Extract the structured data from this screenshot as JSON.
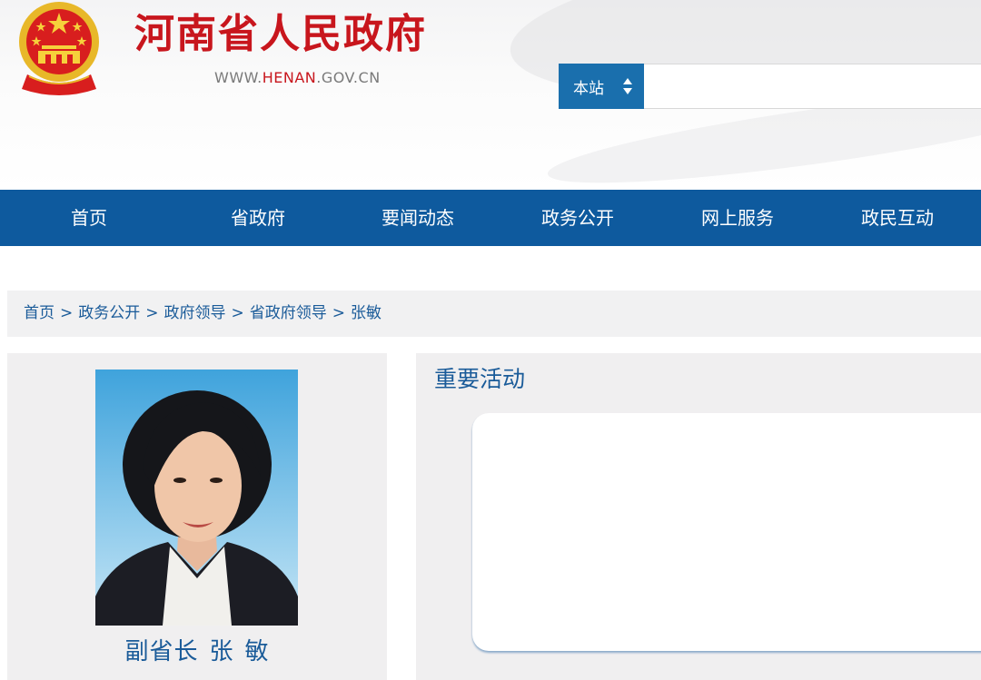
{
  "header": {
    "site_title": "河南省人民政府",
    "url_prefix": "WWW.",
    "url_highlight": "HENAN",
    "url_suffix": ".GOV.CN",
    "search_scope_label": "本站",
    "search_placeholder": ""
  },
  "nav": {
    "items": [
      {
        "label": "首页"
      },
      {
        "label": "省政府"
      },
      {
        "label": "要闻动态"
      },
      {
        "label": "政务公开"
      },
      {
        "label": "网上服务"
      },
      {
        "label": "政民互动"
      }
    ]
  },
  "breadcrumb": {
    "items": [
      "首页",
      "政务公开",
      "政府领导",
      "省政府领导",
      "张敏"
    ],
    "separator": ">"
  },
  "leader": {
    "title": "副省长",
    "surname": "张",
    "given_name": "敏"
  },
  "activities": {
    "section_title": "重要活动"
  },
  "colors": {
    "nav_bg": "#0e5a9e",
    "title_red": "#c8161d",
    "link_blue": "#1a5b99",
    "panel_bg": "#f0eff0"
  }
}
